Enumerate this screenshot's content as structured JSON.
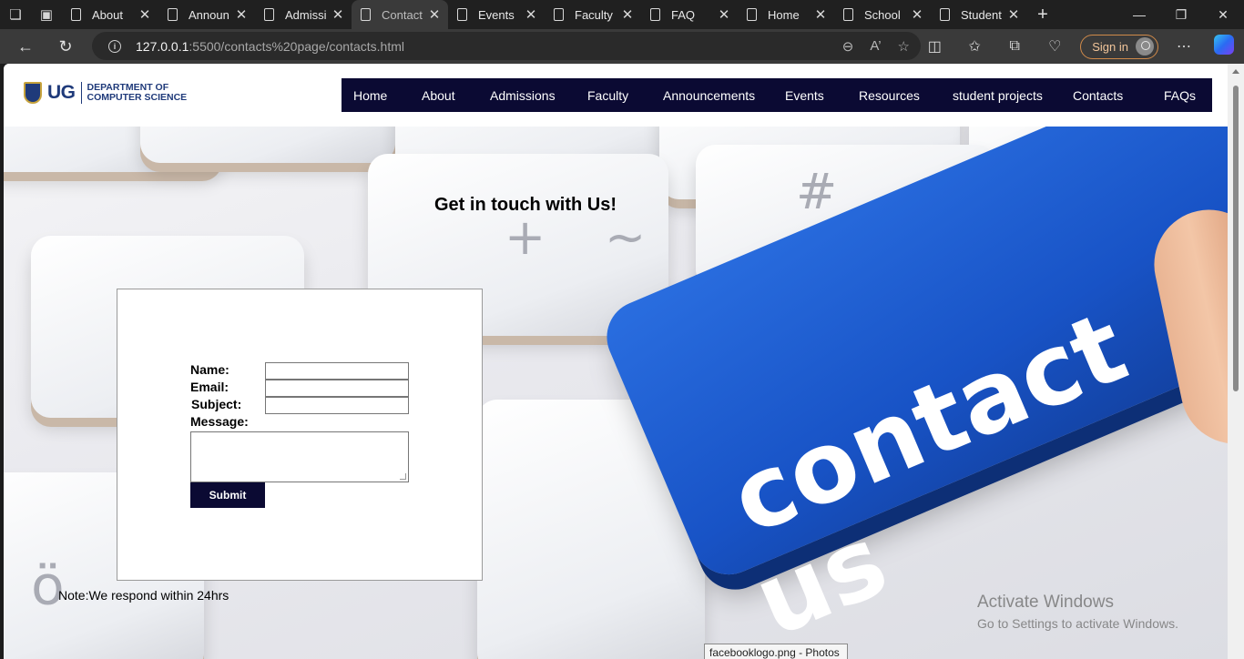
{
  "browser": {
    "tabs": [
      {
        "label": "About",
        "active": false
      },
      {
        "label": "Announ",
        "active": false
      },
      {
        "label": "Admissi",
        "active": false
      },
      {
        "label": "Contact",
        "active": true
      },
      {
        "label": "Events",
        "active": false
      },
      {
        "label": "Faculty",
        "active": false
      },
      {
        "label": "FAQ",
        "active": false
      },
      {
        "label": "Home",
        "active": false
      },
      {
        "label": "School",
        "active": false
      },
      {
        "label": "Student",
        "active": false
      }
    ],
    "url_host": "127.0.0.1",
    "url_path": ":5500/contacts%20page/contacts.html",
    "sign_in": "Sign in",
    "icons": {
      "back": "back-arrow-icon",
      "refresh": "refresh-icon",
      "info": "info-icon",
      "zoom": "zoom-out-icon",
      "read_aloud": "read-aloud-icon",
      "favorite": "star-icon",
      "split": "split-screen-icon",
      "favorites": "favorites-icon",
      "collections": "collections-icon",
      "health": "browser-essentials-icon",
      "more": "more-icon",
      "copilot": "copilot-icon"
    }
  },
  "site": {
    "logo": {
      "mark": "UG",
      "line1": "DEPARTMENT OF",
      "line2": "COMPUTER SCIENCE"
    },
    "nav": [
      "Home",
      "About",
      "Admissions",
      "Faculty",
      "Announcements",
      "Events",
      "Resources",
      "student projects",
      "Contacts",
      "FAQs"
    ],
    "nav_color": "#0b0a33"
  },
  "hero": {
    "image_text": "contact us"
  },
  "page": {
    "title": "Get in touch with Us!",
    "form": {
      "name_label": "Name:",
      "email_label": "Email:",
      "subject_label": "Subject:",
      "message_label": "Message:",
      "name_value": "",
      "email_value": "",
      "subject_value": "",
      "message_value": "",
      "submit_label": "Submit"
    },
    "note": "Note:We respond within 24hrs"
  },
  "os": {
    "watermark_line1": "Activate Windows",
    "watermark_line2": "Go to Settings to activate Windows.",
    "tooltip": "facebooklogo.png - Photos"
  }
}
